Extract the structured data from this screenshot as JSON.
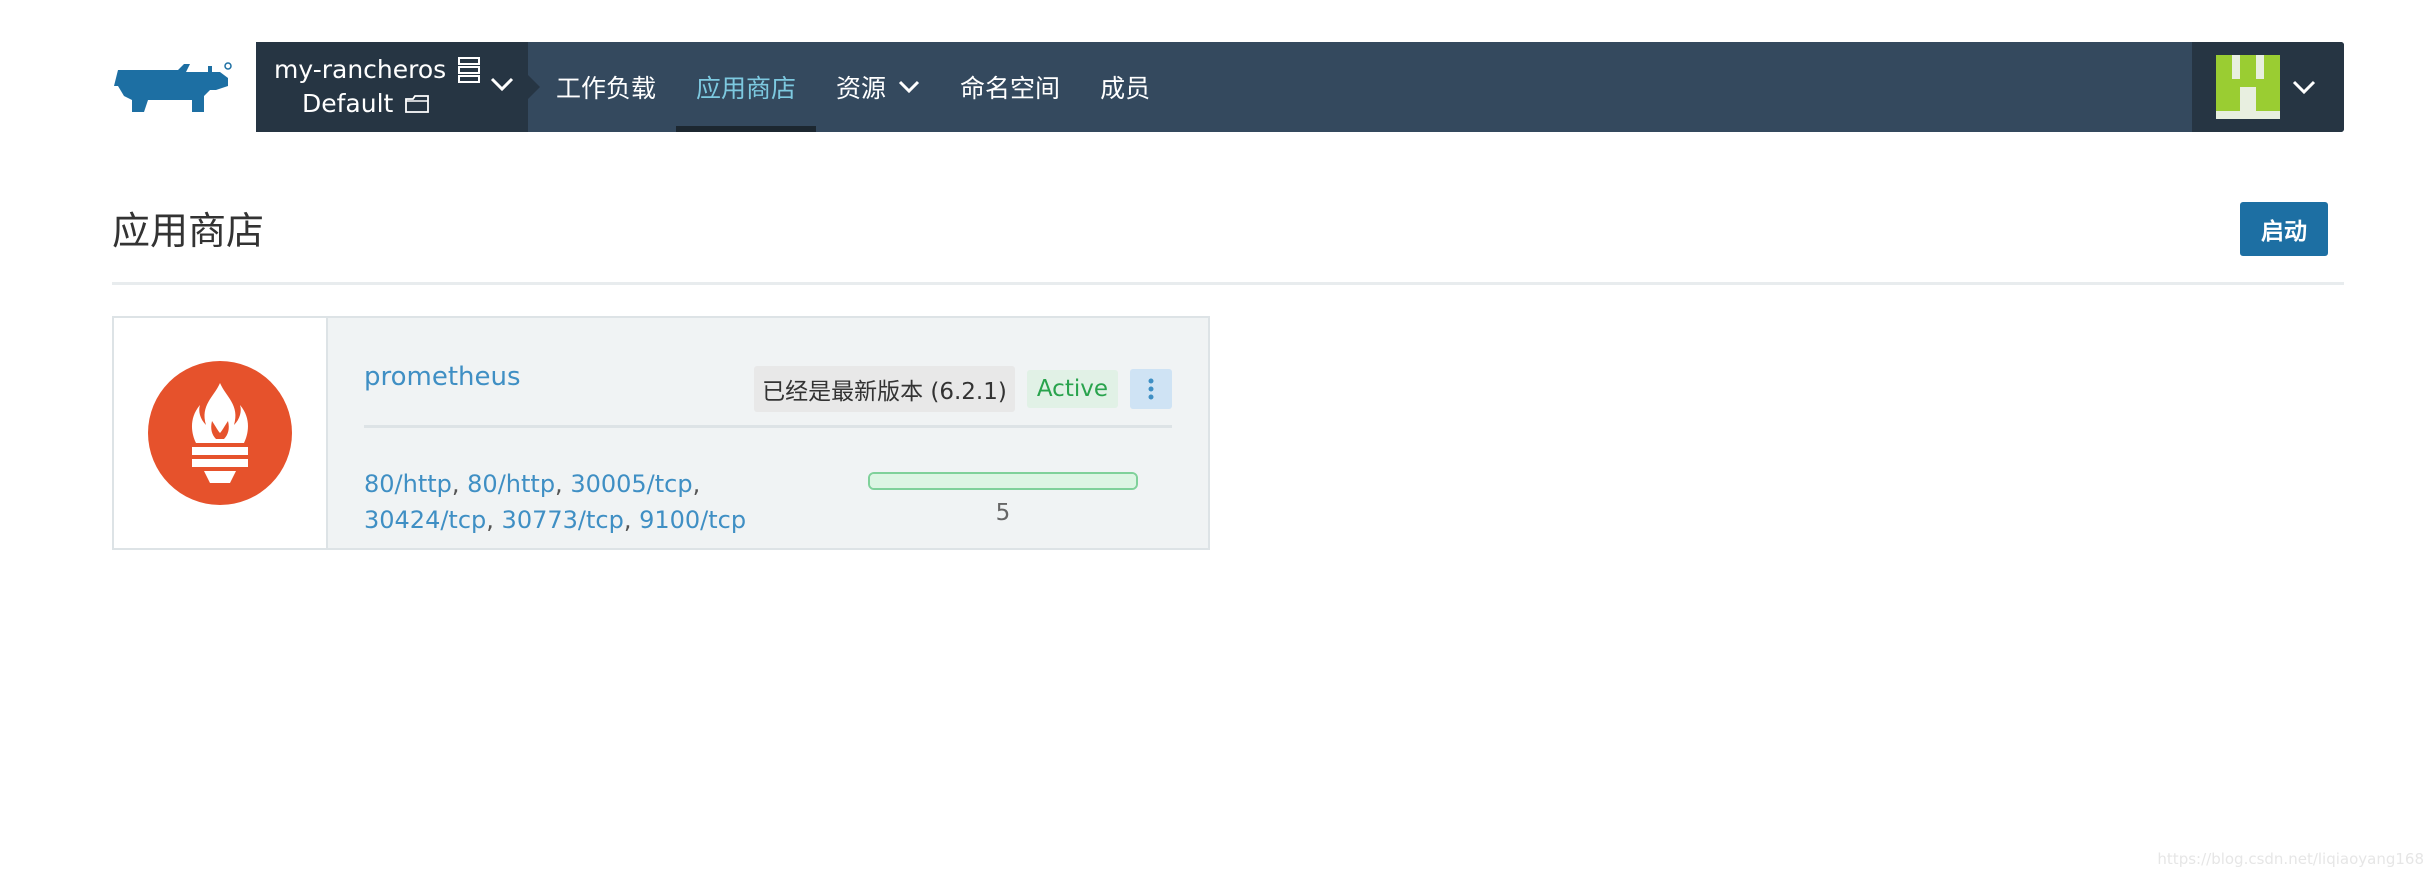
{
  "nav": {
    "cluster_name": "my-rancheros",
    "project_name": "Default",
    "items": [
      {
        "label": "工作负载"
      },
      {
        "label": "应用商店"
      },
      {
        "label": "资源"
      },
      {
        "label": "命名空间"
      },
      {
        "label": "成员"
      }
    ],
    "active_item": "应用商店"
  },
  "header": {
    "title": "应用商店",
    "launch_label": "启动"
  },
  "app": {
    "name": "prometheus",
    "version_label": "已经是最新版本 (6.2.1)",
    "state": "Active",
    "endpoints": [
      "80/http",
      "80/http",
      "30005/tcp",
      "30424/tcp",
      "30773/tcp",
      "9100/tcp"
    ],
    "workload_count": "5",
    "workload_active_fraction": 1.0
  },
  "watermark": "https://blog.csdn.net/liqiaoyang168",
  "colors": {
    "navbar": "#34495e",
    "nav_dark": "#263543",
    "accent": "#1d6fa3",
    "link": "#3f8fc4",
    "active_green": "#29a34d",
    "prometheus_orange": "#e6522c"
  }
}
